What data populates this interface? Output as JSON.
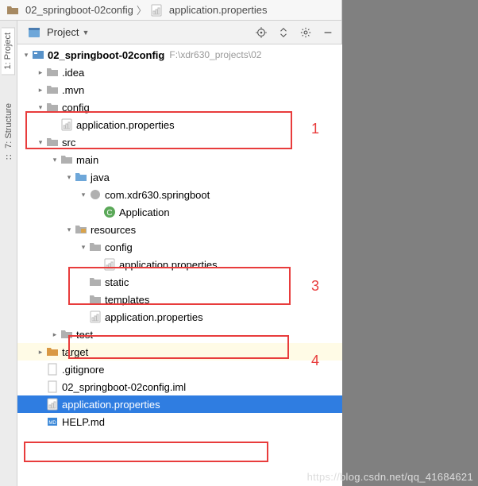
{
  "breadcrumb": {
    "root": "02_springboot-02config",
    "file": "application.properties"
  },
  "toolbar": {
    "project_label": "Project"
  },
  "left_tabs": {
    "t1": "1: Project",
    "t2": "7: Structure"
  },
  "tree": {
    "root_name": "02_springboot-02config",
    "root_path": "F:\\xdr630_projects\\02",
    "idea": ".idea",
    "mvn": ".mvn",
    "config": "config",
    "app_props": "application.properties",
    "src": "src",
    "main": "main",
    "java": "java",
    "pkg": "com.xdr630.springboot",
    "app_class": "Application",
    "resources": "resources",
    "static": "static",
    "templates": "templates",
    "test": "test",
    "target": "target",
    "gitignore": ".gitignore",
    "iml": "02_springboot-02config.iml",
    "help": "HELP.md"
  },
  "annotations": {
    "a1": "1",
    "a3": "3",
    "a4": "4"
  },
  "watermark": "https://blog.csdn.net/qq_41684621"
}
